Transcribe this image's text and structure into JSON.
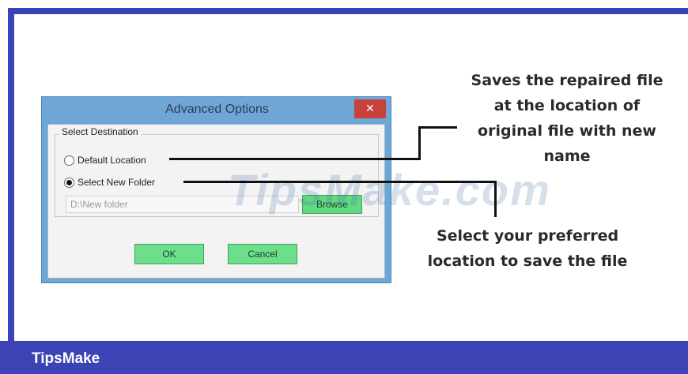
{
  "dialog": {
    "title": "Advanced Options",
    "close_icon": "close-icon",
    "group_label": "Select Destination",
    "options": [
      {
        "label": "Default Location",
        "checked": false
      },
      {
        "label": "Select New Folder",
        "checked": true
      }
    ],
    "path_value": "D:\\New folder",
    "browse_label": "Browse",
    "ok_label": "OK",
    "cancel_label": "Cancel"
  },
  "callouts": {
    "first_lines": [
      "Saves the repaired file",
      "at the location of",
      "original file with new",
      "name"
    ],
    "second_lines": [
      "Select your preferred",
      "location to save the file"
    ]
  },
  "watermark": "TipsMake.com",
  "footer": {
    "brand": "TipsMake"
  },
  "colors": {
    "frame": "#3b43b5",
    "dialog_border": "#6ea7d6",
    "button_green": "#6cde8c",
    "close_red": "#c9413b"
  }
}
